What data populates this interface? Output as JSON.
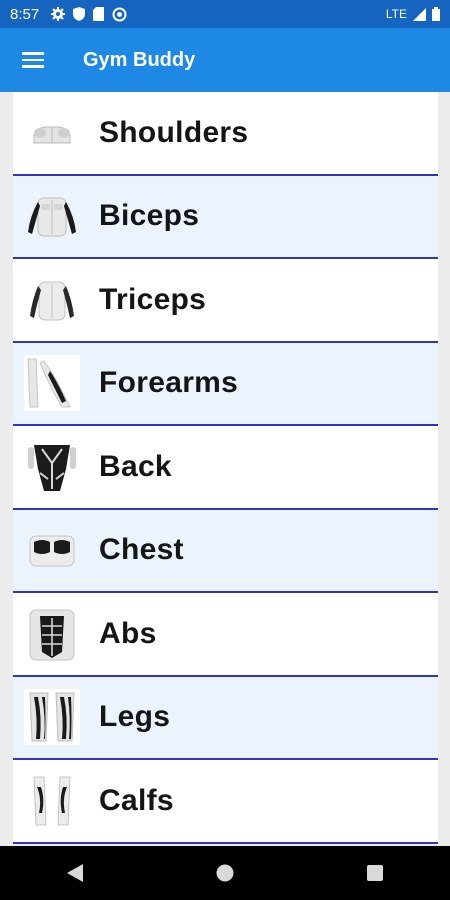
{
  "status_bar": {
    "time": "8:57",
    "network": "LTE",
    "icons": [
      "gear-icon",
      "shield-icon",
      "sd-card-icon",
      "sync-icon",
      "signal-icon",
      "battery-icon"
    ]
  },
  "app_bar": {
    "title": "Gym Buddy",
    "menu_icon": "hamburger-menu-icon"
  },
  "muscle_groups": [
    {
      "label": "Shoulders",
      "icon": "shoulders-muscle-icon"
    },
    {
      "label": "Biceps",
      "icon": "biceps-muscle-icon"
    },
    {
      "label": "Triceps",
      "icon": "triceps-muscle-icon"
    },
    {
      "label": "Forearms",
      "icon": "forearms-muscle-icon"
    },
    {
      "label": "Back",
      "icon": "back-muscle-icon"
    },
    {
      "label": "Chest",
      "icon": "chest-muscle-icon"
    },
    {
      "label": "Abs",
      "icon": "abs-muscle-icon"
    },
    {
      "label": "Legs",
      "icon": "legs-muscle-icon"
    },
    {
      "label": "Calfs",
      "icon": "calfs-muscle-icon"
    }
  ],
  "nav_bar": {
    "icons": [
      "back-icon",
      "home-icon",
      "recents-icon"
    ]
  },
  "colors": {
    "status_bar": "#1565c0",
    "app_bar": "#1e88e5",
    "row_divider": "#2d35c9",
    "row_alt_bg": "#ebf4fd"
  }
}
